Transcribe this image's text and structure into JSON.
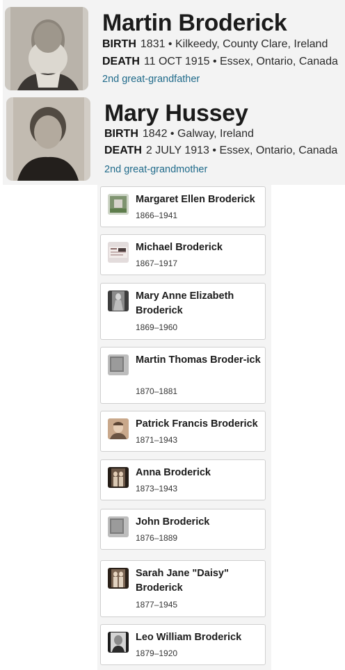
{
  "father": {
    "name": "Martin Broderick",
    "birth_label": "BIRTH",
    "birth_value": "1831 • Kilkeedy, County Clare, Ireland",
    "death_label": "DEATH",
    "death_value": "11 OCT 1915 • Essex, Ontario, Canada",
    "relationship": "2nd great-grandfather"
  },
  "mother": {
    "name": "Mary Hussey",
    "birth_label": "BIRTH",
    "birth_value": "1842 • Galway, Ireland",
    "death_label": "DEATH",
    "death_value": "2 JULY 1913 • Essex, Ontario, Canada",
    "relationship": "2nd great-grandmother"
  },
  "children": [
    {
      "name": "Margaret Ellen Broderick",
      "years": "1866–1941",
      "thumb": "grave-photo-icon"
    },
    {
      "name": "Michael Broderick",
      "years": "1867–1917",
      "thumb": "document-photo-icon"
    },
    {
      "name": "Mary Anne Elizabeth Broderick",
      "years": "1869–1960",
      "thumb": "portrait-photo-icon"
    },
    {
      "name": "Martin Thomas Broder-ick",
      "years": "1870–1881",
      "thumb": "placeholder-photo-icon"
    },
    {
      "name": "Patrick Francis Broderick",
      "years": "1871–1943",
      "thumb": "portrait-photo-icon"
    },
    {
      "name": "Anna Broderick",
      "years": "1873–1943",
      "thumb": "portrait-photo-icon"
    },
    {
      "name": "John Broderick",
      "years": "1876–1889",
      "thumb": "placeholder-photo-icon"
    },
    {
      "name": "Sarah Jane \"Daisy\" Broderick",
      "years": "1877–1945",
      "thumb": "portrait-photo-icon"
    },
    {
      "name": "Leo William Broderick",
      "years": "1879–1920",
      "thumb": "portrait-photo-icon"
    }
  ]
}
